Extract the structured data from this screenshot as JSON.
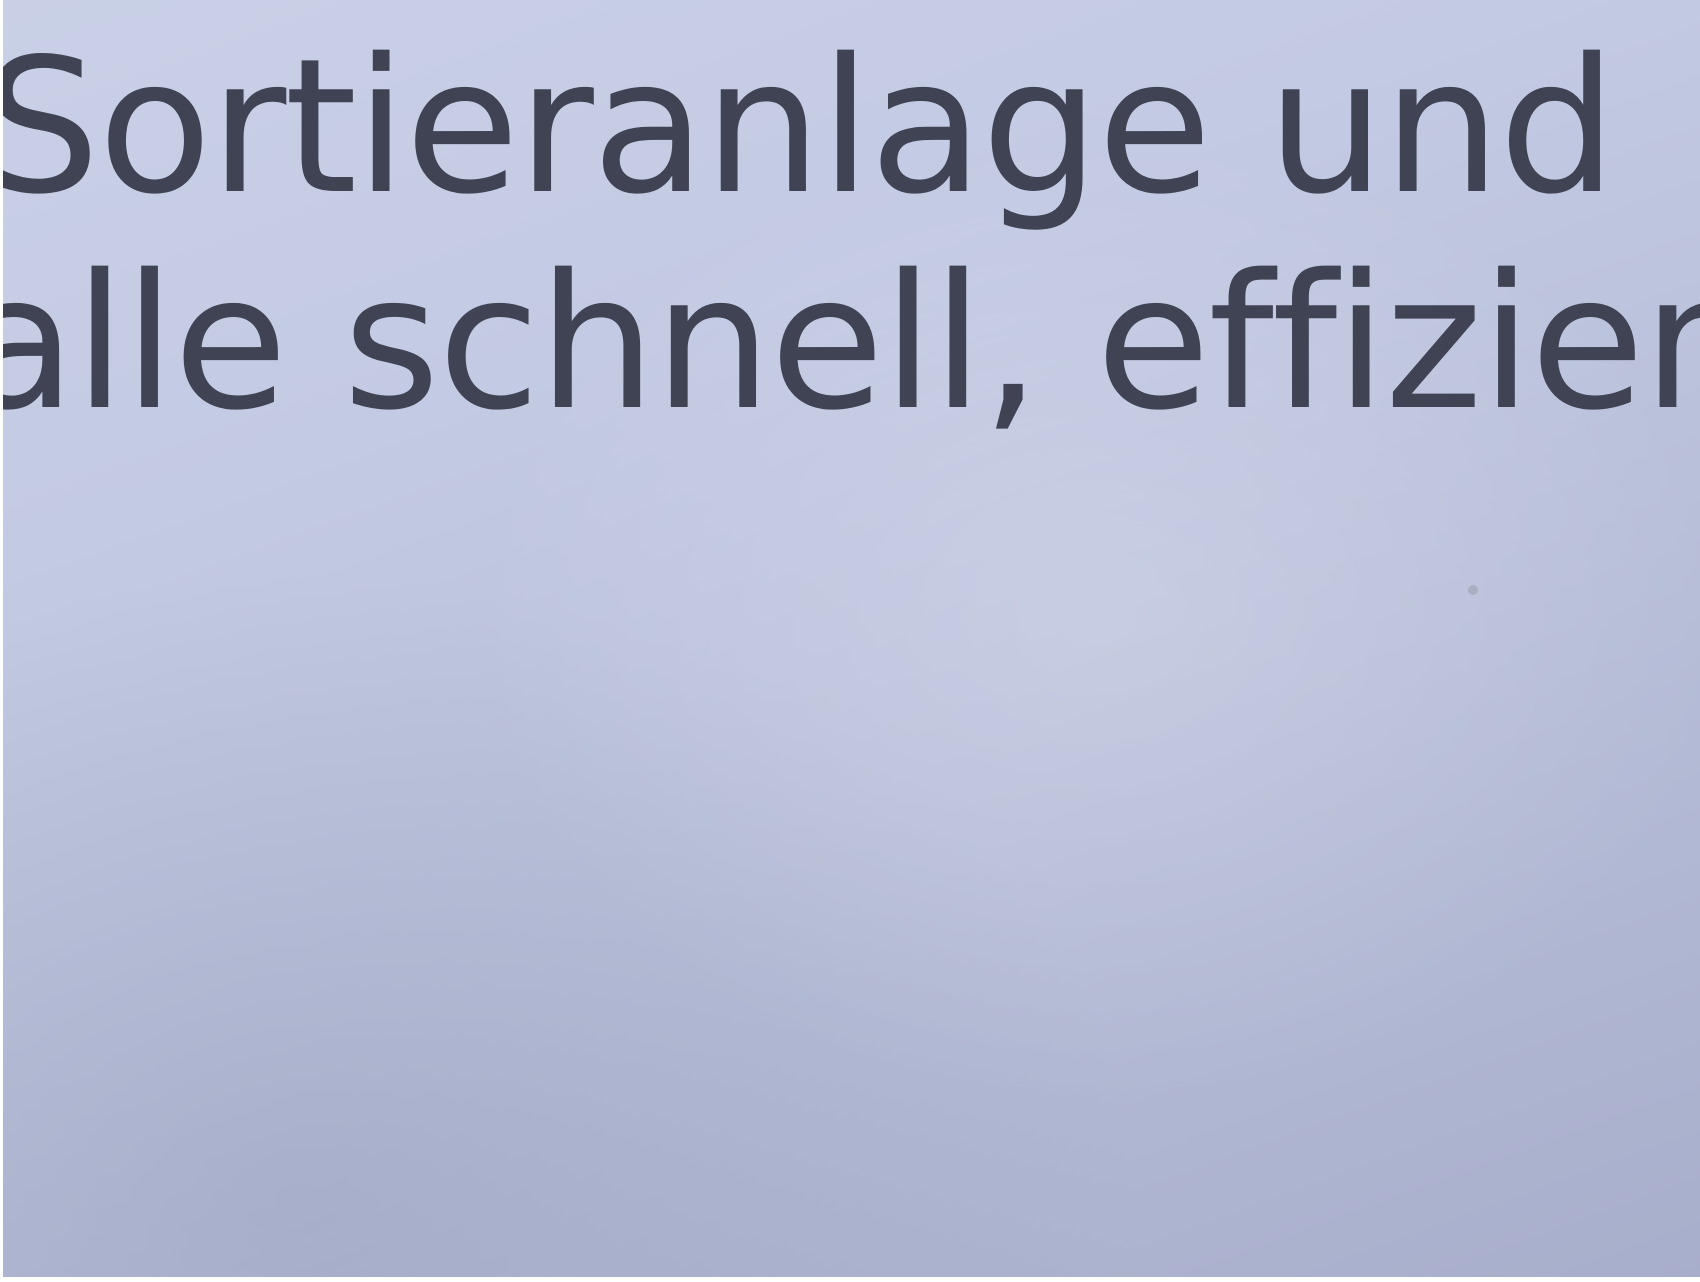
{
  "photo": {
    "lines": [
      "Sortieranlage und",
      "alle schnell, effizient"
    ],
    "colors": {
      "paper": "#c3cae3",
      "ink": "#3f4354"
    }
  }
}
